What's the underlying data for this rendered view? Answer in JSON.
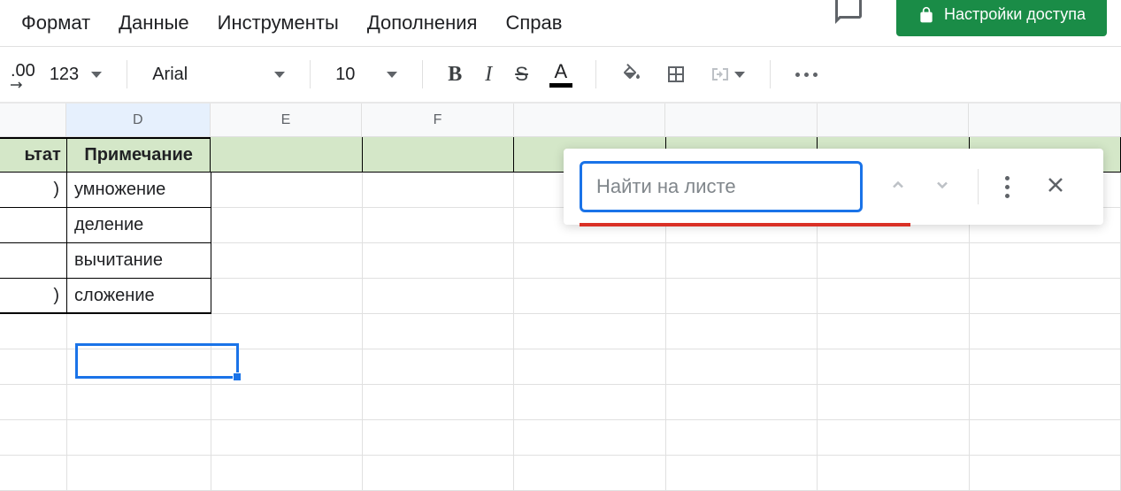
{
  "menubar": {
    "format": "Формат",
    "data": "Данные",
    "tools": "Инструменты",
    "addons": "Дополнения",
    "help": "Справ"
  },
  "share": {
    "label": "Настройки доступа"
  },
  "toolbar": {
    "decimal_label": ".00",
    "number_format": "123",
    "font_name": "Arial",
    "font_size": "10",
    "bold": "B",
    "italic": "I",
    "strike": "S",
    "text_color": "A"
  },
  "columns": {
    "d": "D",
    "e": "E",
    "f": "F"
  },
  "table": {
    "header": {
      "c_partial": "ьтат",
      "d": "Примечание"
    },
    "rows": [
      {
        "c_partial": ")",
        "d": "умножение"
      },
      {
        "c_partial": "",
        "d": "деление"
      },
      {
        "c_partial": "",
        "d": "вычитание"
      },
      {
        "c_partial": ")",
        "d": "сложение"
      }
    ]
  },
  "find": {
    "placeholder": "Найти на листе"
  }
}
